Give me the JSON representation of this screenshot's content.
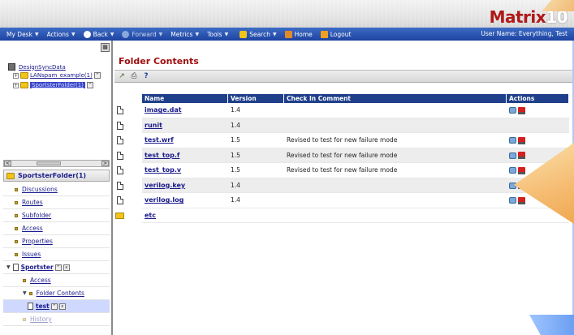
{
  "app": {
    "logo_matrix": "Matrix",
    "logo_version": "10"
  },
  "nav": {
    "items": [
      "My Desk",
      "Actions",
      "Back",
      "Forward",
      "Metrics",
      "Tools",
      "Search",
      "Home",
      "Logout"
    ],
    "user": "User Name: Everything, Test"
  },
  "tree": {
    "root": "DesignSyncData",
    "nodes": [
      "LANspam_example(1)",
      "SportsterFolder(1)"
    ]
  },
  "context": {
    "title": "SportsterFolder(1)",
    "menu": [
      "Discussions",
      "Routes",
      "Subfolder",
      "Access",
      "Properties",
      "Issues"
    ],
    "child": "Sportster",
    "child_menu": [
      "Access",
      "Folder Contents"
    ],
    "grandchild": "test",
    "faded": [
      "History",
      "Folder Contents"
    ]
  },
  "page": {
    "title": "Folder Contents"
  },
  "table": {
    "headers": [
      "Name",
      "Version",
      "Check In Comment",
      "Actions"
    ],
    "rows": [
      {
        "name": "image.dat",
        "version": "1.4",
        "comment": ""
      },
      {
        "name": "runit",
        "version": "1.4",
        "comment": ""
      },
      {
        "name": "test.wrf",
        "version": "1.5",
        "comment": "Revised to test for new failure mode"
      },
      {
        "name": "test_top.f",
        "version": "1.5",
        "comment": "Revised to test for new failure mode"
      },
      {
        "name": "test_top.v",
        "version": "1.5",
        "comment": "Revised to test for new failure mode"
      },
      {
        "name": "verilog.key",
        "version": "1.4",
        "comment": ""
      },
      {
        "name": "verilog.log",
        "version": "1.4",
        "comment": ""
      },
      {
        "name": "etc",
        "version": "",
        "comment": ""
      }
    ]
  },
  "colors": {
    "nav_bg": "#1d43a0",
    "title_red": "#a01010",
    "header_blue": "#1f3f8a",
    "link": "#1a1a8c"
  }
}
